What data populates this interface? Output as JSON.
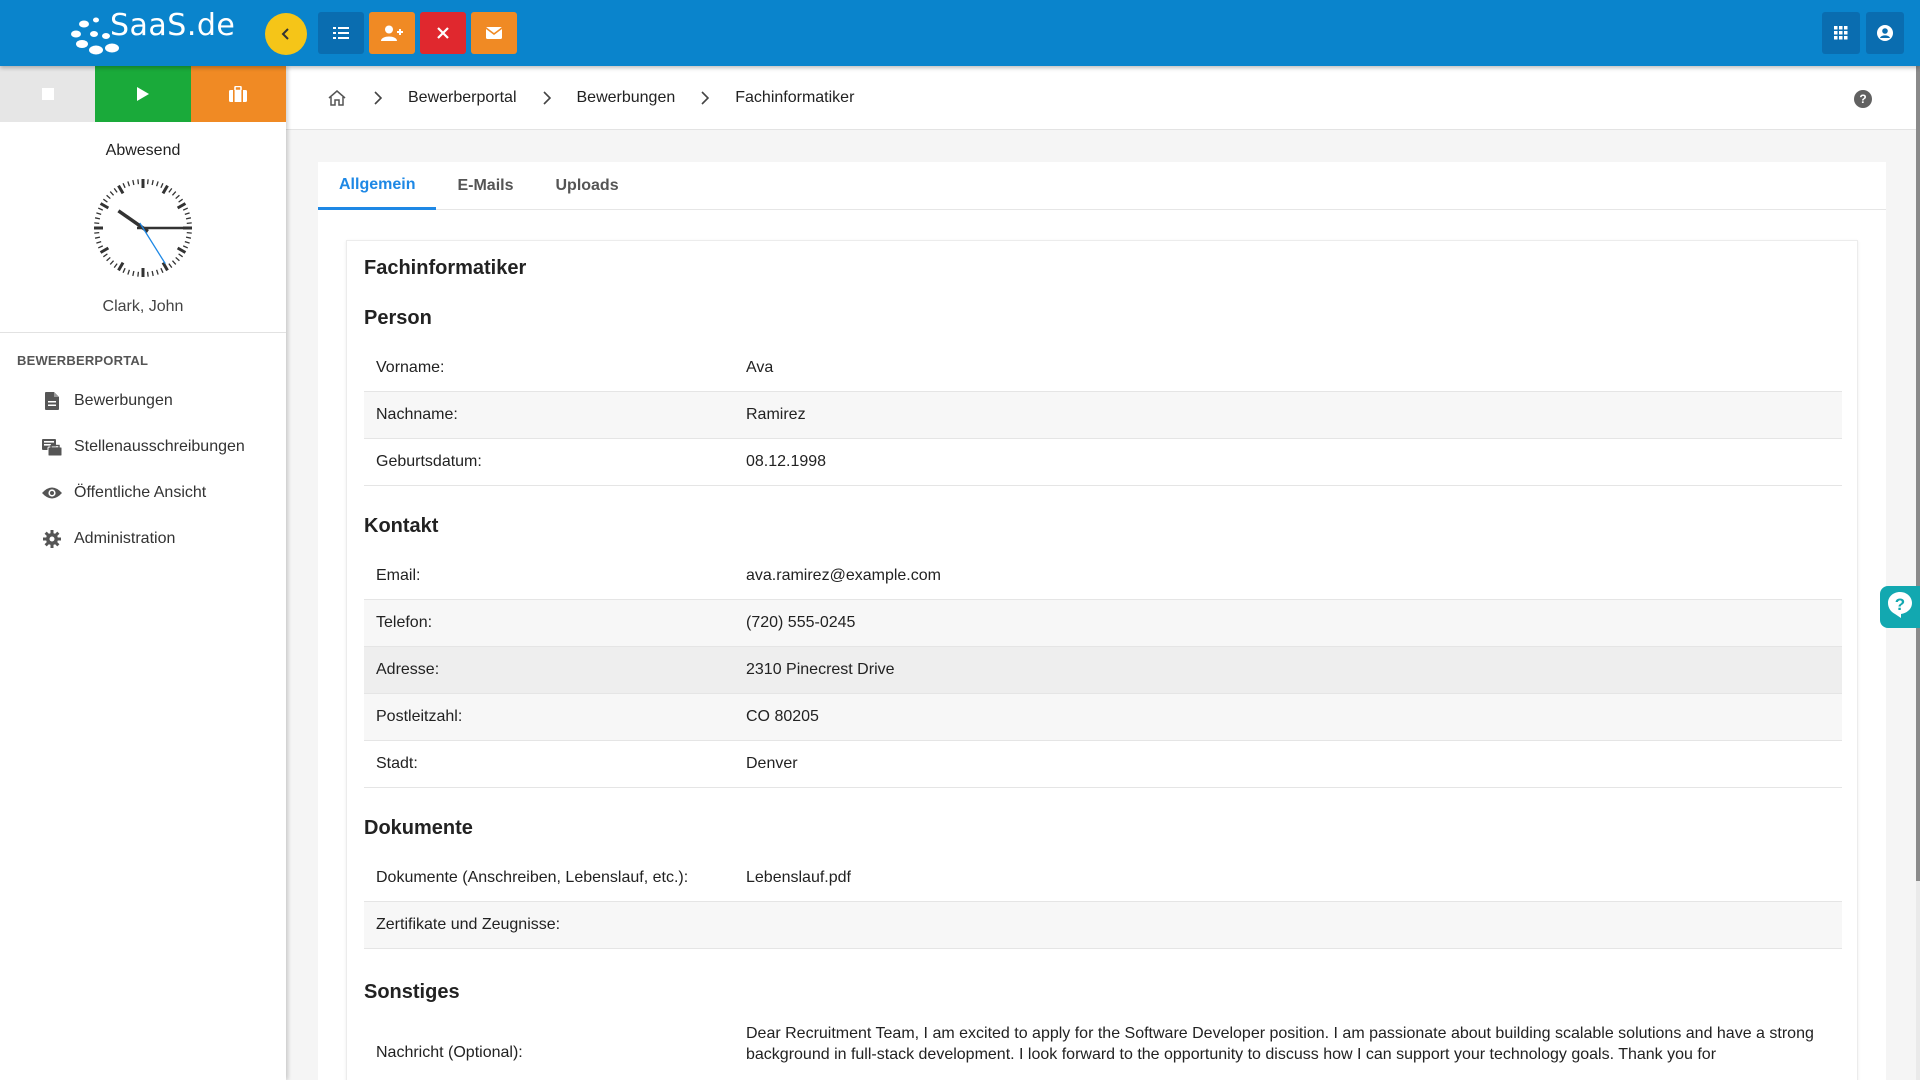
{
  "brand": {
    "logo_text": "SaaS.de"
  },
  "toolbar": {
    "collapse_icon": "chevron-left-icon",
    "buttons": [
      {
        "name": "list",
        "icon": "list-icon",
        "color": "#0a6db0"
      },
      {
        "name": "add-user",
        "icon": "user-plus-icon",
        "color": "#f08a24"
      },
      {
        "name": "close",
        "icon": "close-icon",
        "color": "#e0282e"
      },
      {
        "name": "mail",
        "icon": "envelope-icon",
        "color": "#f08a24"
      }
    ],
    "right_icons": [
      "apps-grid-icon",
      "user-circle-icon"
    ]
  },
  "sidebar": {
    "status_buttons": [
      {
        "icon": "stop-icon",
        "color": "#e6e6e6"
      },
      {
        "icon": "play-icon",
        "color": "#1aaa3a"
      },
      {
        "icon": "briefcase-icon",
        "color": "#f08a24"
      }
    ],
    "status_label": "Abwesend",
    "user_name": "Clark, John",
    "section_title": "BEWERBERPORTAL",
    "items": [
      {
        "label": "Bewerbungen",
        "icon": "document-icon"
      },
      {
        "label": "Stellenausschreibungen",
        "icon": "job-board-icon"
      },
      {
        "label": "Öffentliche Ansicht",
        "icon": "eye-icon"
      },
      {
        "label": "Administration",
        "icon": "gear-icon"
      }
    ]
  },
  "breadcrumb": {
    "items": [
      "Bewerberportal",
      "Bewerbungen"
    ],
    "current": "Fachinformatiker"
  },
  "tabs": [
    {
      "label": "Allgemein",
      "active": true
    },
    {
      "label": "E-Mails",
      "active": false
    },
    {
      "label": "Uploads",
      "active": false
    }
  ],
  "detail": {
    "title": "Fachinformatiker",
    "sections": {
      "person": {
        "heading": "Person",
        "rows": [
          {
            "label": "Vorname:",
            "value": "Ava"
          },
          {
            "label": "Nachname:",
            "value": "Ramirez"
          },
          {
            "label": "Geburtsdatum:",
            "value": "08.12.1998"
          }
        ]
      },
      "kontakt": {
        "heading": "Kontakt",
        "rows": [
          {
            "label": "Email:",
            "value": "ava.ramirez@example.com"
          },
          {
            "label": "Telefon:",
            "value": "(720) 555-0245"
          },
          {
            "label": "Adresse:",
            "value": "2310 Pinecrest Drive"
          },
          {
            "label": "Postleitzahl:",
            "value": "CO 80205"
          },
          {
            "label": "Stadt:",
            "value": "Denver"
          }
        ]
      },
      "dokumente": {
        "heading": "Dokumente",
        "rows": [
          {
            "label": "Dokumente (Anschreiben, Lebenslauf, etc.):",
            "value": "Lebenslauf.pdf"
          },
          {
            "label": "Zertifikate und Zeugnisse:",
            "value": ""
          }
        ]
      },
      "sonstiges": {
        "heading": "Sonstiges",
        "rows": [
          {
            "label": "Nachricht (Optional):",
            "value": "Dear Recruitment Team, I am excited to apply for the Software Developer position. I am passionate about building scalable solutions and have a strong background in full-stack development. I look forward to the opportunity to discuss how I can support your technology goals. Thank you for"
          }
        ]
      }
    }
  },
  "colors": {
    "topbar": "#0a84cc",
    "accent": "#1e88e5",
    "help_float": "#12a8b0",
    "collapse": "#f5c518"
  }
}
